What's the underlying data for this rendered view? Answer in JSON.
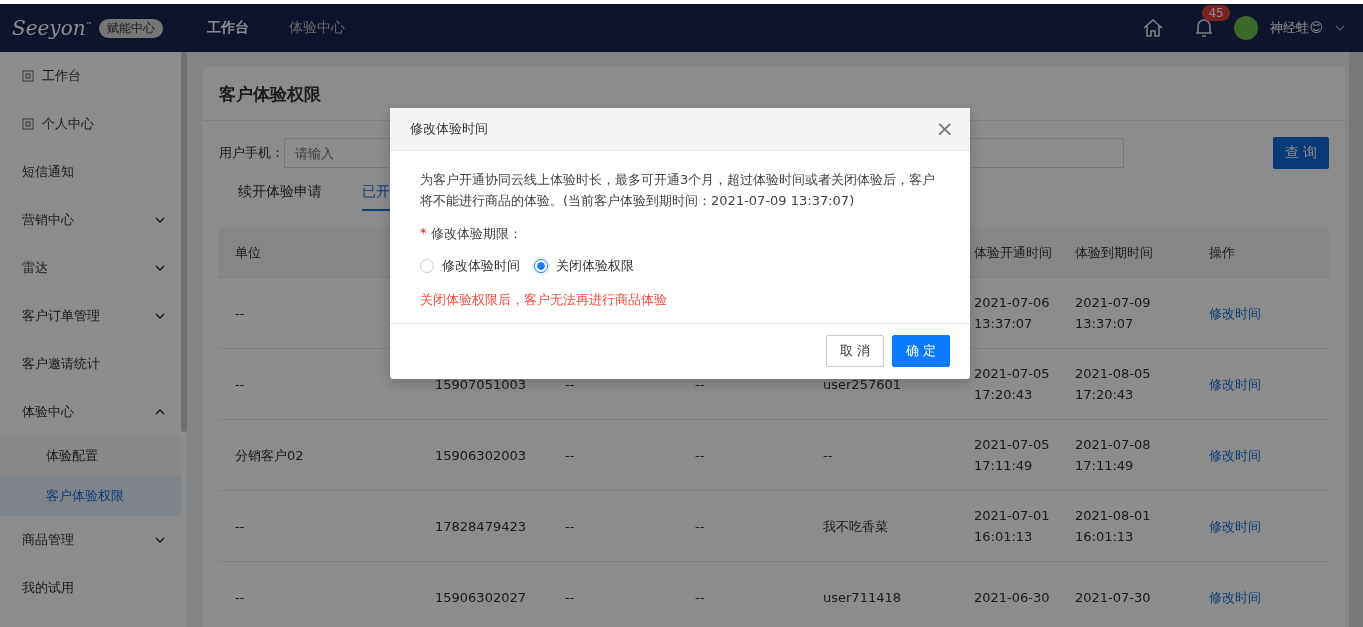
{
  "topbar": {
    "logo": "Seeyon",
    "trademark": "™",
    "badge": "赋能中心",
    "nav": [
      {
        "label": "工作台",
        "selected": true
      },
      {
        "label": "体验中心",
        "selected": false
      }
    ],
    "notifications": "45",
    "user": "神经蛙😊"
  },
  "sidebar": {
    "items": [
      {
        "label": "工作台",
        "kind": "icon",
        "selected": false
      },
      {
        "label": "个人中心",
        "kind": "icon",
        "selected": false
      },
      {
        "label": "短信通知",
        "kind": "plain",
        "selected": false
      },
      {
        "label": "营销中心",
        "kind": "group",
        "expanded": false,
        "selected": false
      },
      {
        "label": "雷达",
        "kind": "group",
        "expanded": false,
        "selected": false
      },
      {
        "label": "客户订单管理",
        "kind": "group",
        "expanded": false,
        "selected": false
      },
      {
        "label": "客户邀请统计",
        "kind": "plain",
        "selected": false
      },
      {
        "label": "体验中心",
        "kind": "group",
        "expanded": true,
        "selected": false,
        "children": [
          {
            "label": "体验配置",
            "selected": false
          },
          {
            "label": "客户体验权限",
            "selected": true
          }
        ]
      },
      {
        "label": "商品管理",
        "kind": "group",
        "expanded": false,
        "selected": false
      },
      {
        "label": "我的试用",
        "kind": "plain",
        "selected": false
      }
    ]
  },
  "page": {
    "title": "客户体验权限",
    "filter": {
      "label": "用户手机：",
      "placeholder": "请输入"
    },
    "query_button": "查 询",
    "tabs": [
      {
        "label": "续开体验申请",
        "selected": false
      },
      {
        "label": "已开",
        "selected": true
      }
    ],
    "table": {
      "columns": [
        "单位",
        "",
        "",
        "",
        "",
        "体验开通时间",
        "体验到期时间",
        "操作"
      ],
      "rows": [
        [
          "--",
          "",
          "",
          "",
          "",
          "2021-07-06 13:37:07",
          "2021-07-09 13:37:07",
          "修改时间"
        ],
        [
          "--",
          "15907051003",
          "--",
          "--",
          "user257601",
          "2021-07-05 17:20:43",
          "2021-08-05 17:20:43",
          "修改时间"
        ],
        [
          "分销客户02",
          "15906302003",
          "--",
          "--",
          "--",
          "2021-07-05 17:11:49",
          "2021-07-08 17:11:49",
          "修改时间"
        ],
        [
          "--",
          "17828479423",
          "--",
          "--",
          "我不吃香菜",
          "2021-07-01 16:01:13",
          "2021-08-01 16:01:13",
          "修改时间"
        ],
        [
          "--",
          "15906302027",
          "--",
          "--",
          "user711418",
          "2021-06-30",
          "2021-07-30",
          "修改时间"
        ]
      ]
    }
  },
  "dialog": {
    "title": "修改体验时间",
    "close": "×",
    "description": "为客户开通协同云线上体验时长，最多可开通3个月，超过体验时间或者关闭体验后，客户将不能进行商品的体验。(当前客户体验到期时间：2021-07-09 13:37:07)",
    "required_mark": "*",
    "field_label": "修改体验期限：",
    "options": [
      {
        "label": "修改体验时间",
        "selected": false
      },
      {
        "label": "关闭体验权限",
        "selected": true
      }
    ],
    "warning": "关闭体验权限后，客户无法再进行商品体验",
    "buttons": [
      {
        "label": "取 消",
        "kind": "default"
      },
      {
        "label": "确 定",
        "kind": "primary"
      }
    ]
  }
}
